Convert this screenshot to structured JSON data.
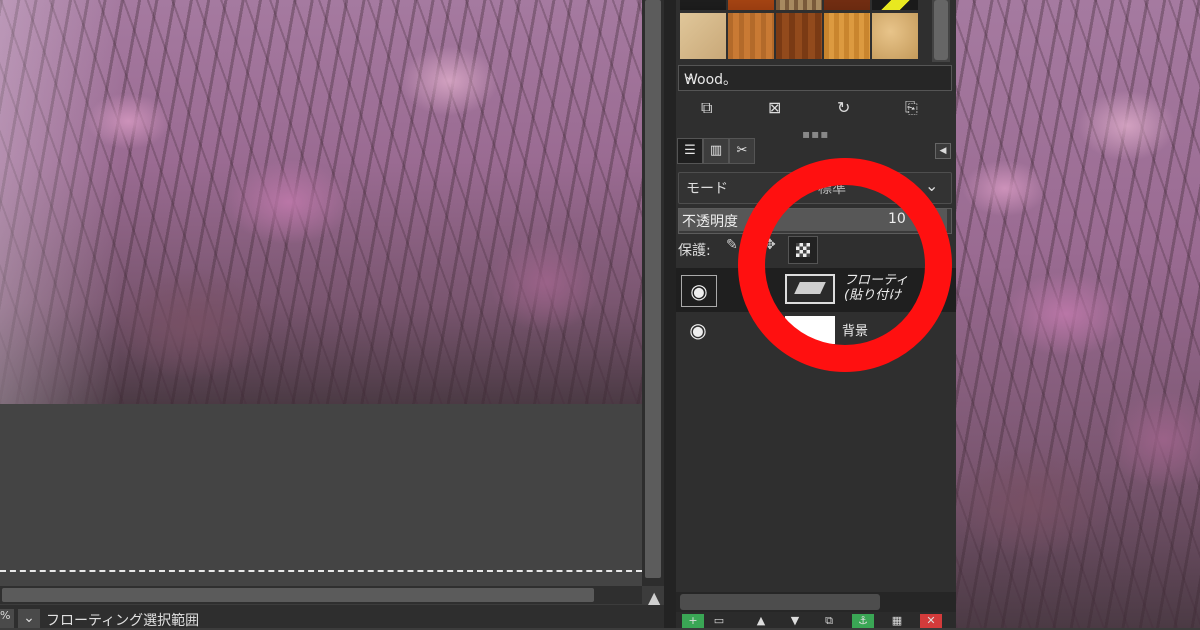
{
  "patterns": {
    "selected_name": "Wood。"
  },
  "layers_panel": {
    "mode_label": "モード",
    "mode_value": "標準",
    "opacity_label": "不透明度",
    "opacity_value": "10",
    "lock_label": "保護:",
    "layers": [
      {
        "name_line1": "フローティ",
        "name_line2": "(貼り付け"
      },
      {
        "name": "背景"
      }
    ]
  },
  "statusbar": {
    "zoom": "%",
    "text": "フローティング選択範囲"
  },
  "colors": {
    "highlight_ring": "#ff1010",
    "delete_button": "#d33b3b",
    "add_button": "#3aa655"
  }
}
